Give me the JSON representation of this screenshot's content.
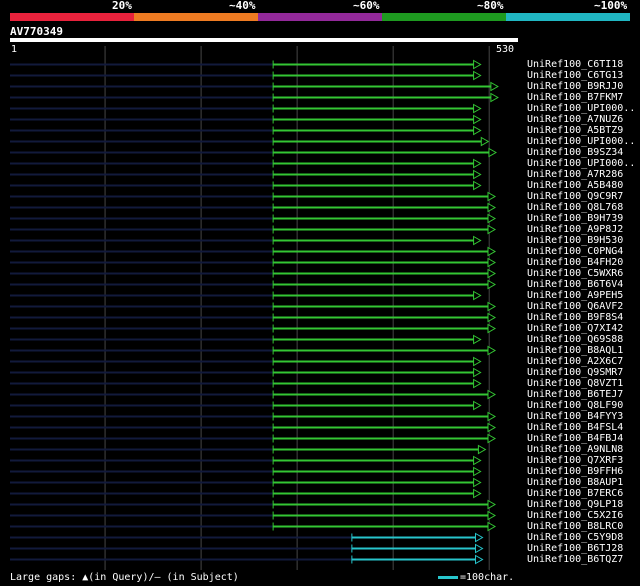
{
  "legend": {
    "labels": [
      "20%",
      "~40%",
      "~60%",
      "~80%",
      "~100%"
    ],
    "colors": [
      "#e8223c",
      "#ee7b22",
      "#93299a",
      "#1e9a20",
      "#20b6c2"
    ]
  },
  "query": {
    "name": "AV770349",
    "start": "1",
    "end": "530",
    "length": 530
  },
  "hits": [
    {
      "label": "UniRef100_C6TI18",
      "qstart": 275,
      "qend": 490,
      "color": "green"
    },
    {
      "label": "UniRef100_C6TG13",
      "qstart": 275,
      "qend": 490,
      "color": "green"
    },
    {
      "label": "UniRef100_B9RJJ0",
      "qstart": 275,
      "qend": 508,
      "color": "green"
    },
    {
      "label": "UniRef100_B7FKM7",
      "qstart": 275,
      "qend": 508,
      "color": "green"
    },
    {
      "label": "UniRef100_UPI000..",
      "qstart": 275,
      "qend": 490,
      "color": "green"
    },
    {
      "label": "UniRef100_A7NUZ6",
      "qstart": 275,
      "qend": 490,
      "color": "green"
    },
    {
      "label": "UniRef100_A5BTZ9",
      "qstart": 275,
      "qend": 490,
      "color": "green"
    },
    {
      "label": "UniRef100_UPI000..",
      "qstart": 275,
      "qend": 498,
      "color": "green"
    },
    {
      "label": "UniRef100_B9SZ34",
      "qstart": 275,
      "qend": 506,
      "color": "green"
    },
    {
      "label": "UniRef100_UPI000..",
      "qstart": 275,
      "qend": 490,
      "color": "green"
    },
    {
      "label": "UniRef100_A7R286",
      "qstart": 275,
      "qend": 490,
      "color": "green"
    },
    {
      "label": "UniRef100_A5B480",
      "qstart": 275,
      "qend": 490,
      "color": "green"
    },
    {
      "label": "UniRef100_Q9C9R7",
      "qstart": 275,
      "qend": 505,
      "color": "green"
    },
    {
      "label": "UniRef100_Q8L768",
      "qstart": 275,
      "qend": 505,
      "color": "green"
    },
    {
      "label": "UniRef100_B9H739",
      "qstart": 275,
      "qend": 505,
      "color": "green"
    },
    {
      "label": "UniRef100_A9P8J2",
      "qstart": 275,
      "qend": 505,
      "color": "green"
    },
    {
      "label": "UniRef100_B9H530",
      "qstart": 275,
      "qend": 490,
      "color": "green"
    },
    {
      "label": "UniRef100_C0PNG4",
      "qstart": 275,
      "qend": 505,
      "color": "green"
    },
    {
      "label": "UniRef100_B4FH20",
      "qstart": 275,
      "qend": 505,
      "color": "green"
    },
    {
      "label": "UniRef100_C5WXR6",
      "qstart": 275,
      "qend": 505,
      "color": "green"
    },
    {
      "label": "UniRef100_B6T6V4",
      "qstart": 275,
      "qend": 505,
      "color": "green"
    },
    {
      "label": "UniRef100_A9PEH5",
      "qstart": 275,
      "qend": 490,
      "color": "green"
    },
    {
      "label": "UniRef100_Q6AVF2",
      "qstart": 275,
      "qend": 505,
      "color": "green"
    },
    {
      "label": "UniRef100_B9F8S4",
      "qstart": 275,
      "qend": 505,
      "color": "green"
    },
    {
      "label": "UniRef100_Q7XI42",
      "qstart": 275,
      "qend": 505,
      "color": "green"
    },
    {
      "label": "UniRef100_Q69S88",
      "qstart": 275,
      "qend": 490,
      "color": "green"
    },
    {
      "label": "UniRef100_B8AQL1",
      "qstart": 275,
      "qend": 505,
      "color": "green"
    },
    {
      "label": "UniRef100_A2X6C7",
      "qstart": 275,
      "qend": 490,
      "color": "green"
    },
    {
      "label": "UniRef100_Q9SMR7",
      "qstart": 275,
      "qend": 490,
      "color": "green"
    },
    {
      "label": "UniRef100_Q8VZT1",
      "qstart": 275,
      "qend": 490,
      "color": "green"
    },
    {
      "label": "UniRef100_B6TEJ7",
      "qstart": 275,
      "qend": 505,
      "color": "green"
    },
    {
      "label": "UniRef100_Q8LF90",
      "qstart": 275,
      "qend": 490,
      "color": "green"
    },
    {
      "label": "UniRef100_B4FYY3",
      "qstart": 275,
      "qend": 505,
      "color": "green"
    },
    {
      "label": "UniRef100_B4FSL4",
      "qstart": 275,
      "qend": 505,
      "color": "green"
    },
    {
      "label": "UniRef100_B4FBJ4",
      "qstart": 275,
      "qend": 505,
      "color": "green"
    },
    {
      "label": "UniRef100_A9NLN8",
      "qstart": 275,
      "qend": 495,
      "color": "green"
    },
    {
      "label": "UniRef100_Q7XRF3",
      "qstart": 275,
      "qend": 490,
      "color": "green"
    },
    {
      "label": "UniRef100_B9FFH6",
      "qstart": 275,
      "qend": 490,
      "color": "green"
    },
    {
      "label": "UniRef100_B8AUP1",
      "qstart": 275,
      "qend": 490,
      "color": "green"
    },
    {
      "label": "UniRef100_B7ERC6",
      "qstart": 275,
      "qend": 490,
      "color": "green"
    },
    {
      "label": "UniRef100_Q9LP18",
      "qstart": 275,
      "qend": 505,
      "color": "green"
    },
    {
      "label": "UniRef100_C5X2I6",
      "qstart": 275,
      "qend": 505,
      "color": "green"
    },
    {
      "label": "UniRef100_B8LRC0",
      "qstart": 275,
      "qend": 505,
      "color": "green"
    },
    {
      "label": "UniRef100_C5Y9D8",
      "qstart": 357,
      "qend": 492,
      "color": "cyan"
    },
    {
      "label": "UniRef100_B6TJ28",
      "qstart": 357,
      "qend": 492,
      "color": "cyan"
    },
    {
      "label": "UniRef100_B6TQZ7",
      "qstart": 357,
      "qend": 492,
      "color": "cyan"
    }
  ],
  "footer": {
    "text": "Large gaps: ▲(in Query)/– (in Subject)",
    "scale": "=100char."
  },
  "colors": {
    "green": "#34c634",
    "cyan": "#27c5cc",
    "track": "#121a3c",
    "grid": "#454545"
  }
}
